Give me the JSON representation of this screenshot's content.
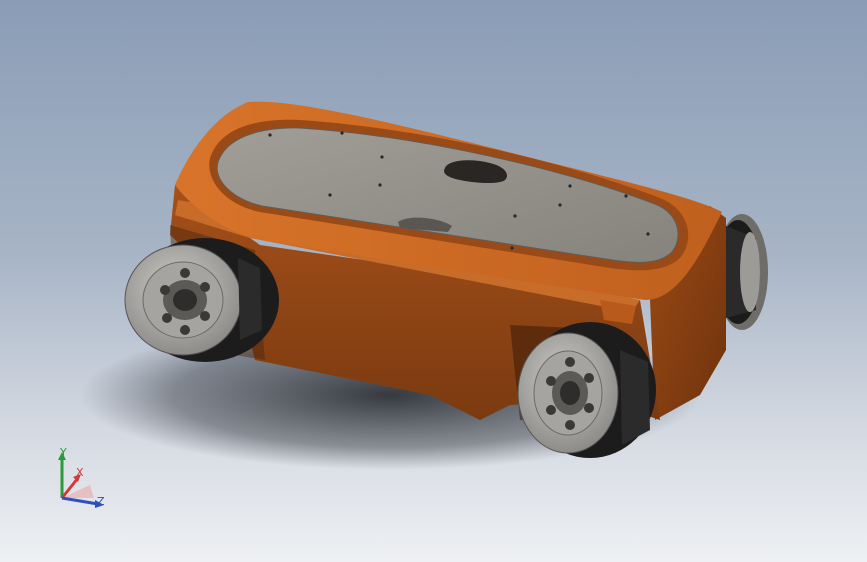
{
  "scene": {
    "model": "robot-chassis",
    "body_color": "#c4621e",
    "deck_color": "#8d8983",
    "wheel_color": "#b9b7b3"
  },
  "triad": {
    "x_label": "X",
    "y_label": "Y",
    "z_label": "Z",
    "x_color": "#d23a3a",
    "y_color": "#2a9a3a",
    "z_color": "#2f4fbf"
  }
}
